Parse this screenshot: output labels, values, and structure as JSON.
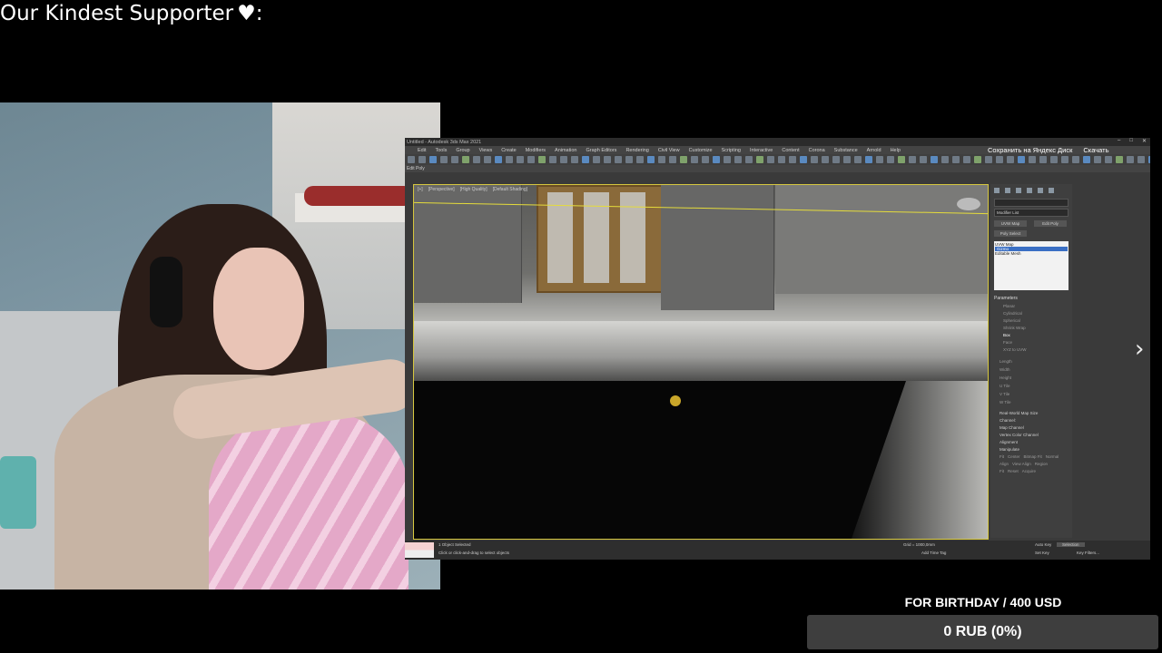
{
  "overlay": {
    "supporter_label": "Our Kindest Supporter",
    "heart_icon": "heart-icon",
    "supporter_suffix": ":"
  },
  "app": {
    "title": "Untitled - Autodesk 3ds Max 2021",
    "menu": [
      "Edit",
      "Tools",
      "Group",
      "Views",
      "Create",
      "Modifiers",
      "Animation",
      "Graph Editors",
      "Rendering",
      "Civil View",
      "Customize",
      "Scripting",
      "Interactive",
      "Content",
      "Corona",
      "Substance",
      "Arnold",
      "Help"
    ],
    "yandex_save": "Сохранить на Яндекс Диск",
    "yandex_download": "Скачать",
    "ribbon_label": "Edit Poly",
    "viewport_labels": [
      "[+]",
      "[Perspective]",
      "[High Quality]",
      "[Default Shading]"
    ],
    "command_panel": {
      "modifier_list": "Modifier List",
      "buttons": [
        "UVW Map",
        "Edit Poly",
        "Poly Select"
      ],
      "stack": [
        "UVW Map",
        "Gizmo",
        "Editable Mesh"
      ],
      "selected_stack_item": "Gizmo",
      "params_title": "Parameters",
      "mapping_options": [
        "Planar",
        "Cylindrical",
        "Spherical",
        "Shrink Wrap",
        "Box",
        "Face",
        "XYZ to UVW"
      ],
      "selected_mapping": "Box",
      "fields": [
        "Length",
        "Width",
        "Height",
        "U Tile",
        "V Tile",
        "W Tile"
      ],
      "other": [
        "Real-World Map Size",
        "Channel:",
        "Map Channel",
        "Vertex Color Channel",
        "Alignment",
        "Manipulate",
        "Fit",
        "Center",
        "Bitmap Fit",
        "Normal Align",
        "View Align",
        "Region Fit",
        "Reset",
        "Acquire"
      ]
    },
    "status": {
      "selection": "1 Object Selected",
      "hint": "Click or click-and-drag to select objects",
      "grid": "Grid = 1000,0mm",
      "add_time_tag": "Add Time Tag",
      "auto_key": "Auto Key",
      "selection_dropdown": "Selection",
      "set_key": "Set Key",
      "key_filters": "Key Filters..."
    }
  },
  "next_arrow_icon": "chevron-right-icon",
  "goal": {
    "title": "FOR BIRTHDAY / 400 USD",
    "progress_text": "0 RUB (0%)",
    "progress_fraction": 0
  }
}
